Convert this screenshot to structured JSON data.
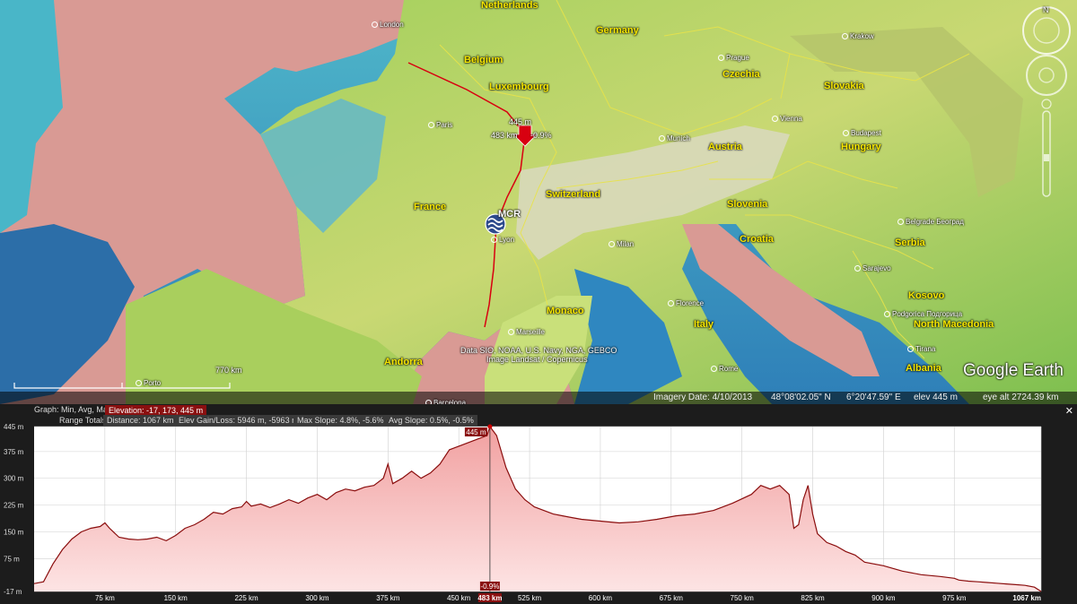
{
  "map": {
    "countries": [
      {
        "name": "Netherlands",
        "pos": [
          536,
          0
        ]
      },
      {
        "name": "Germany",
        "pos": [
          664,
          28
        ]
      },
      {
        "name": "Belgium",
        "pos": [
          517,
          61
        ]
      },
      {
        "name": "Luxembourg",
        "pos": [
          545,
          91
        ]
      },
      {
        "name": "Czechia",
        "pos": [
          805,
          77
        ]
      },
      {
        "name": "Slovakia",
        "pos": [
          918,
          90
        ]
      },
      {
        "name": "Hungary",
        "pos": [
          937,
          158
        ]
      },
      {
        "name": "Austria",
        "pos": [
          789,
          158
        ]
      },
      {
        "name": "Switzerland",
        "pos": [
          608,
          211
        ]
      },
      {
        "name": "France",
        "pos": [
          461,
          225
        ]
      },
      {
        "name": "Slovenia",
        "pos": [
          810,
          222
        ]
      },
      {
        "name": "Croatia",
        "pos": [
          824,
          261
        ]
      },
      {
        "name": "Serbia",
        "pos": [
          997,
          265
        ]
      },
      {
        "name": "Kosovo",
        "pos": [
          1012,
          324
        ]
      },
      {
        "name": "North Macedonia",
        "pos": [
          1018,
          356
        ]
      },
      {
        "name": "Italy",
        "pos": [
          773,
          356
        ]
      },
      {
        "name": "Monaco",
        "pos": [
          609,
          341
        ]
      },
      {
        "name": "Andorra",
        "pos": [
          428,
          398
        ]
      },
      {
        "name": "Albania",
        "pos": [
          1009,
          405
        ]
      }
    ],
    "cities": [
      {
        "name": "London",
        "pos": [
          414,
          23
        ]
      },
      {
        "name": "Krakow",
        "pos": [
          938,
          36
        ]
      },
      {
        "name": "Prague",
        "pos": [
          800,
          60
        ]
      },
      {
        "name": "Paris",
        "pos": [
          477,
          135
        ]
      },
      {
        "name": "Vienna",
        "pos": [
          860,
          128
        ]
      },
      {
        "name": "Budapest",
        "pos": [
          939,
          144
        ]
      },
      {
        "name": "Munich",
        "pos": [
          734,
          150
        ]
      },
      {
        "name": "Belgrade Београд",
        "pos": [
          1000,
          243
        ]
      },
      {
        "name": "Lyon",
        "pos": [
          547,
          263
        ]
      },
      {
        "name": "Milan",
        "pos": [
          678,
          268
        ]
      },
      {
        "name": "Sarajevo",
        "pos": [
          952,
          295
        ]
      },
      {
        "name": "Florence",
        "pos": [
          744,
          334
        ]
      },
      {
        "name": "Podgorica Подгорица",
        "pos": [
          985,
          346
        ]
      },
      {
        "name": "Marseille",
        "pos": [
          566,
          366
        ]
      },
      {
        "name": "Tirana",
        "pos": [
          1011,
          385
        ]
      },
      {
        "name": "Rome",
        "pos": [
          792,
          407
        ]
      },
      {
        "name": "Porto",
        "pos": [
          151,
          423
        ]
      },
      {
        "name": "Barcelona",
        "pos": [
          474,
          445
        ]
      }
    ],
    "marker_label": "MCR",
    "cursor_elev": "445 m",
    "cursor_dist": "483 km",
    "cursor_slope": "-0.9%",
    "attribution_1": "Data SIO, NOAA, U.S. Navy, NGA, GEBCO",
    "attribution_2": "Image Landsat / Copernicus",
    "scale_label": "770 km",
    "logo_text": "Google Earth",
    "nav_north": "N"
  },
  "status": {
    "imagery_date": "Imagery Date: 4/10/2013",
    "lat": "48°08'02.05\" N",
    "lon": "6°20'47.59\" E",
    "elev": "elev  445 m",
    "eye_alt": "eye alt 2724.39 km"
  },
  "panel": {
    "graph_label": "Graph: Min, Avg, Max",
    "elevation_stats": "Elevation: -17, 173, 445 m",
    "range_totals": "Range Totals:",
    "distance": "Distance: 1067 km",
    "gain_loss": "Elev Gain/Loss: 5946 m, -5963 m",
    "max_slope": "Max Slope: 4.8%, -5.6%",
    "avg_slope": "Avg Slope: 0.5%, -0.5%",
    "close": "✕"
  },
  "chart_data": {
    "type": "area",
    "xlabel": "",
    "ylabel": "",
    "xlim": [
      0,
      1067
    ],
    "ylim": [
      -17,
      445
    ],
    "y_ticks": [
      "445 m",
      "375 m",
      "300 m",
      "225 m",
      "150 m",
      "75 m",
      "-17 m"
    ],
    "y_tick_values": [
      445,
      375,
      300,
      225,
      150,
      75,
      -17
    ],
    "x_ticks": [
      "75 km",
      "150 km",
      "225 km",
      "300 km",
      "375 km",
      "450 km",
      "483 km",
      "525 km",
      "600 km",
      "675 km",
      "750 km",
      "825 km",
      "900 km",
      "975 km",
      "1067 km"
    ],
    "x_tick_values": [
      75,
      150,
      225,
      300,
      375,
      450,
      483,
      525,
      600,
      675,
      750,
      825,
      900,
      975,
      1067
    ],
    "cursor": {
      "x": 483,
      "y": 445,
      "label_y": "445 m",
      "label_x": "483 km",
      "label_slope": "-0.9%"
    },
    "series": [
      {
        "x": [
          0,
          10,
          20,
          30,
          40,
          50,
          60,
          70,
          75,
          80,
          90,
          100,
          110,
          120,
          130,
          140,
          150,
          160,
          170,
          180,
          190,
          200,
          210,
          220,
          225,
          230,
          240,
          250,
          260,
          270,
          280,
          290,
          300,
          310,
          320,
          330,
          340,
          350,
          360,
          370,
          375,
          380,
          390,
          400,
          410,
          420,
          430,
          440,
          450,
          460,
          470,
          480,
          483,
          490,
          500,
          510,
          520,
          530,
          540,
          550,
          560,
          570,
          580,
          600,
          620,
          640,
          660,
          680,
          700,
          720,
          740,
          760,
          770,
          780,
          790,
          800,
          805,
          810,
          815,
          820,
          825,
          830,
          840,
          850,
          860,
          870,
          880,
          900,
          920,
          940,
          960,
          975,
          980,
          990,
          1000,
          1010,
          1020,
          1030,
          1040,
          1050,
          1060,
          1067
        ],
        "y": [
          5,
          10,
          60,
          100,
          130,
          150,
          160,
          165,
          175,
          160,
          135,
          130,
          128,
          130,
          135,
          125,
          140,
          160,
          170,
          185,
          205,
          200,
          215,
          220,
          235,
          222,
          228,
          218,
          228,
          240,
          230,
          245,
          255,
          240,
          260,
          270,
          265,
          275,
          280,
          300,
          340,
          285,
          300,
          320,
          300,
          315,
          340,
          380,
          390,
          400,
          410,
          420,
          445,
          420,
          330,
          270,
          240,
          220,
          210,
          200,
          195,
          190,
          185,
          180,
          175,
          178,
          185,
          195,
          200,
          210,
          230,
          255,
          280,
          270,
          280,
          255,
          160,
          170,
          240,
          280,
          200,
          145,
          120,
          110,
          95,
          85,
          65,
          55,
          40,
          30,
          25,
          20,
          15,
          12,
          10,
          8,
          6,
          4,
          2,
          0,
          -5,
          -17
        ]
      }
    ]
  }
}
